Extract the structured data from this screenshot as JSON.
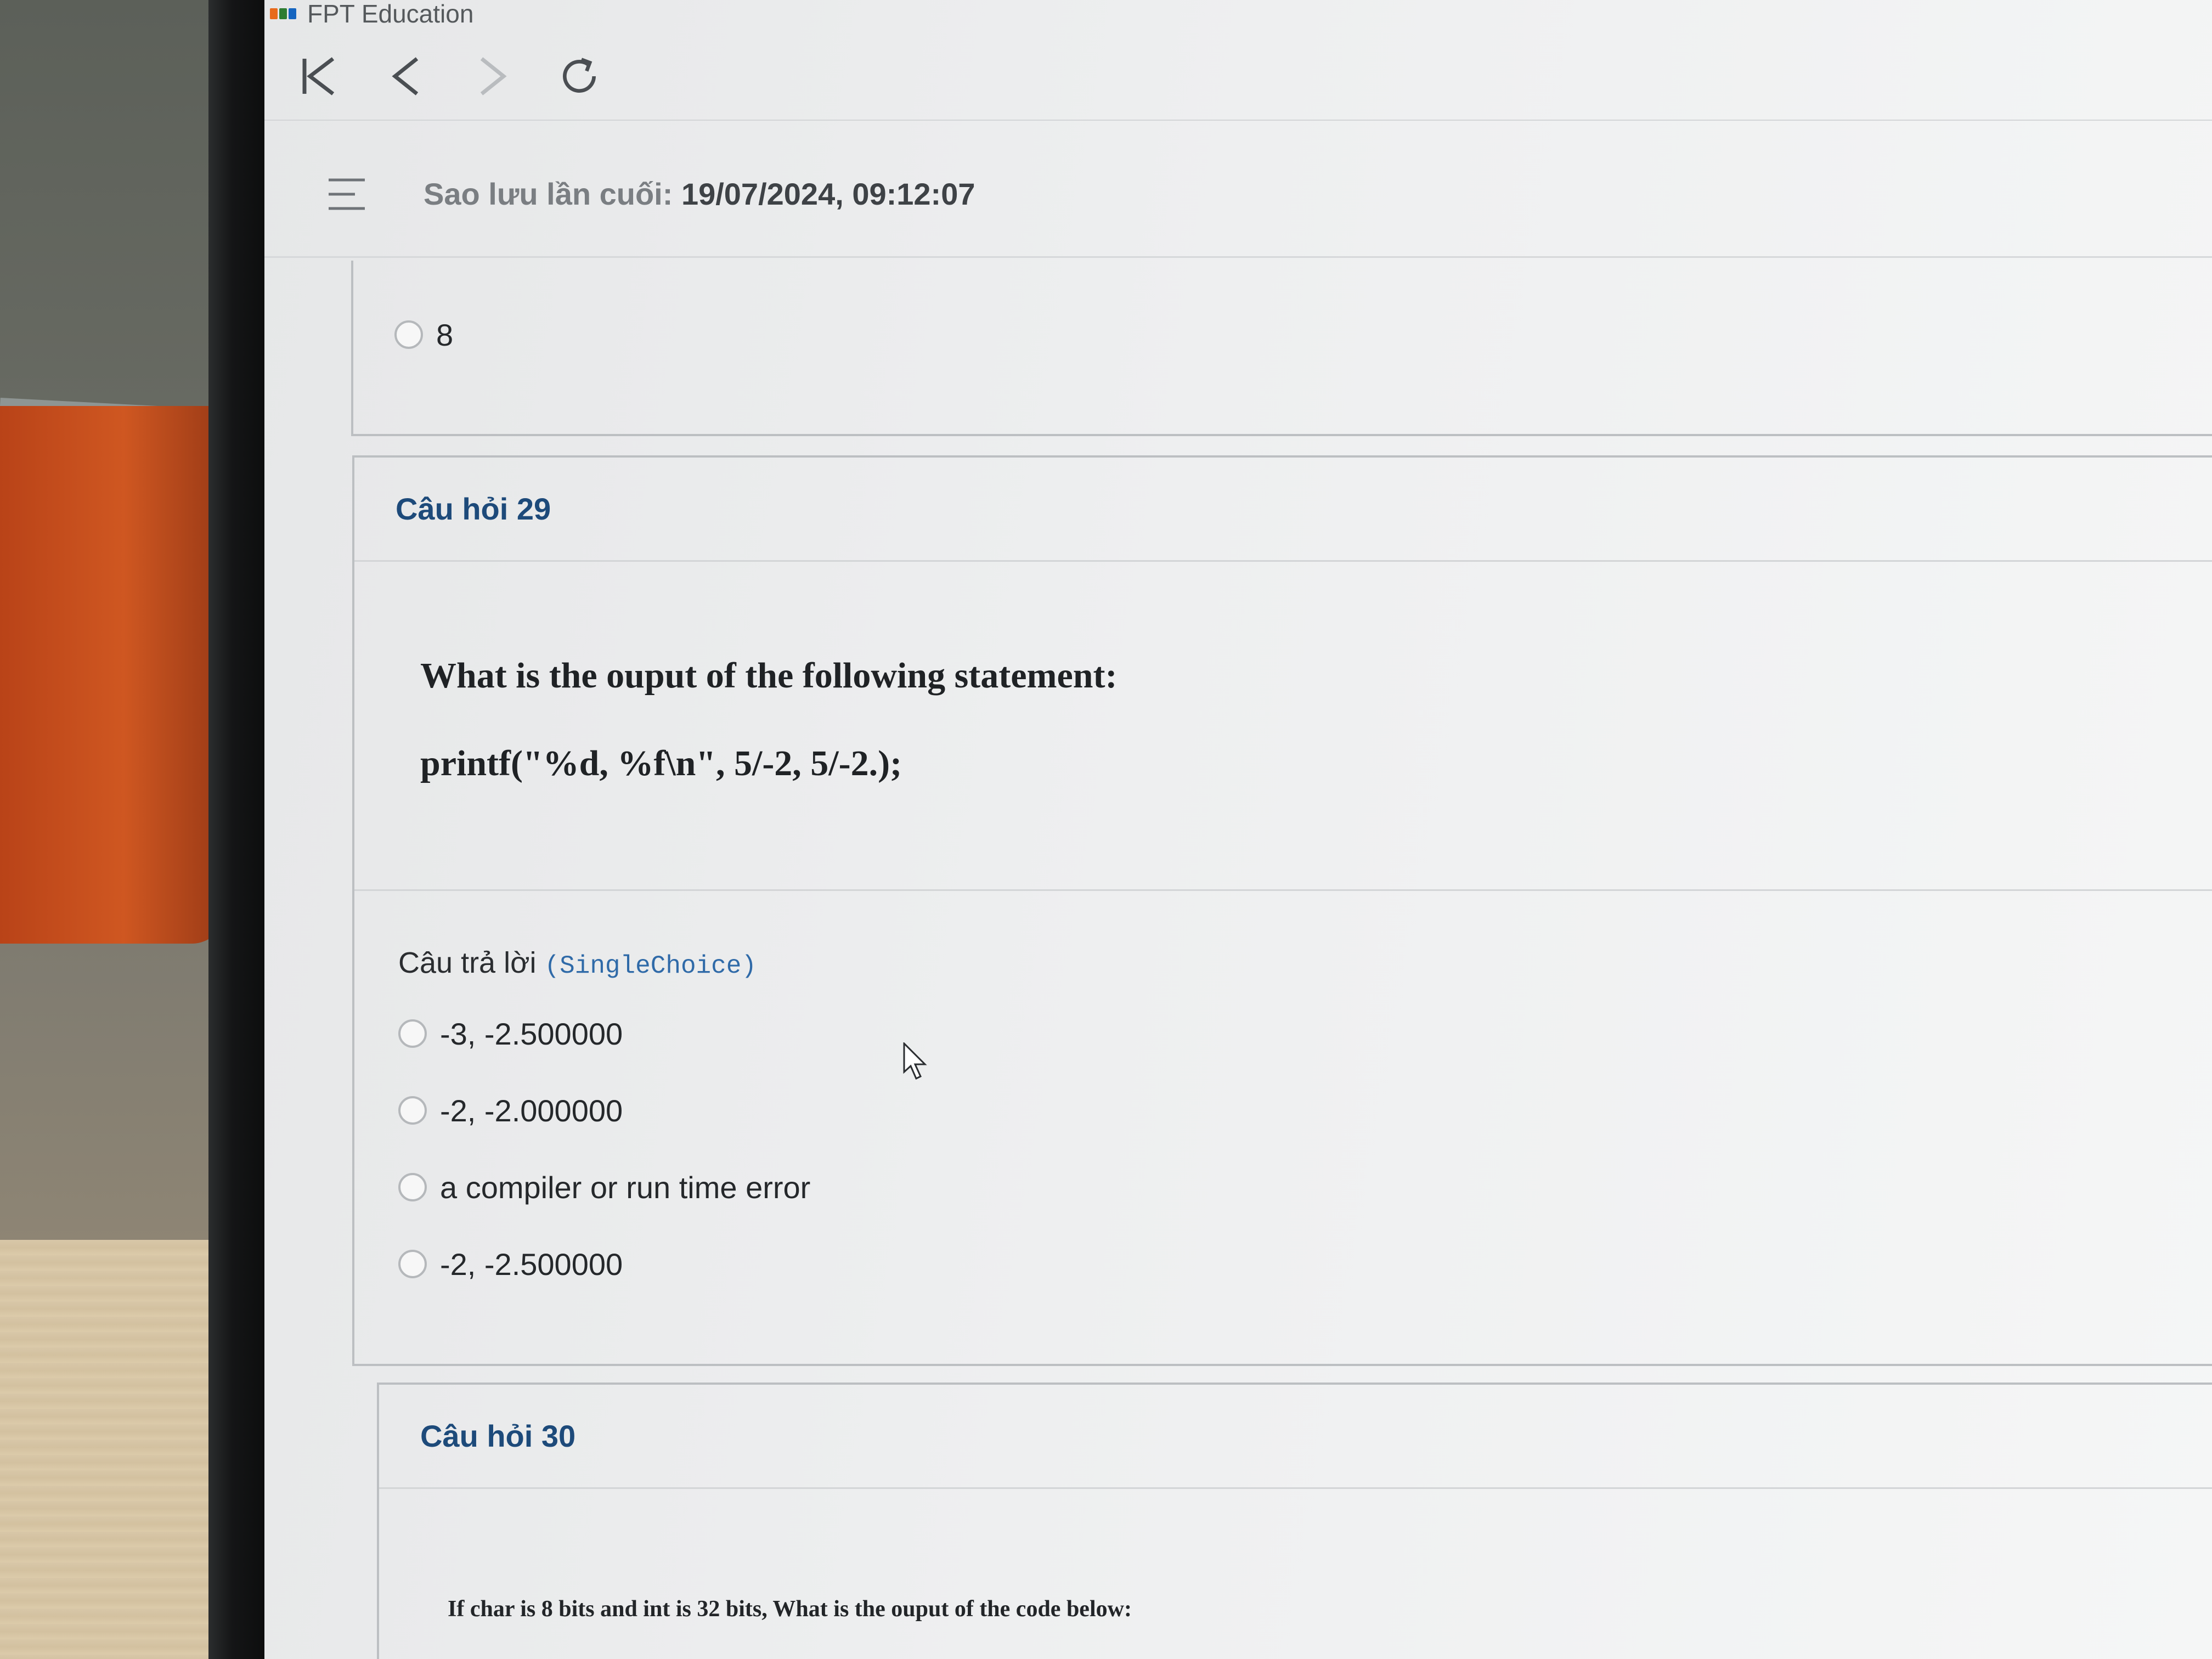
{
  "window": {
    "title": "FPT Education",
    "logo_colors": [
      "#e86a1c",
      "#2e7d32",
      "#1565c0"
    ]
  },
  "nav": {
    "buttons": [
      "first-page-icon",
      "back-icon",
      "forward-icon",
      "reload-icon"
    ]
  },
  "quiz_header": {
    "menu_icon": "hamburger-menu-icon",
    "save_label": "Sao lưu lần cuối:",
    "save_time": "19/07/2024, 09:12:07"
  },
  "previous_question": {
    "option_label": "8"
  },
  "question_29": {
    "number_label": "Câu hỏi 29",
    "text": "What is the ouput of the following statement:",
    "code": "printf(\"%d, %f\\n\", 5/-2, 5/-2.);",
    "answer_title": "Câu trả lời",
    "answer_type": "(SingleChoice)",
    "options": [
      "-3, -2.500000",
      "-2, -2.000000",
      "a compiler or run time error",
      "-2, -2.500000"
    ]
  },
  "question_30": {
    "number_label": "Câu hỏi 30",
    "text": "If char is 8 bits and int is 32 bits, What is the ouput of the code below:"
  },
  "colors": {
    "question_number": "#1d4a7a",
    "answer_type": "#2f6aa8",
    "radio_border": "#b5b8bb"
  }
}
